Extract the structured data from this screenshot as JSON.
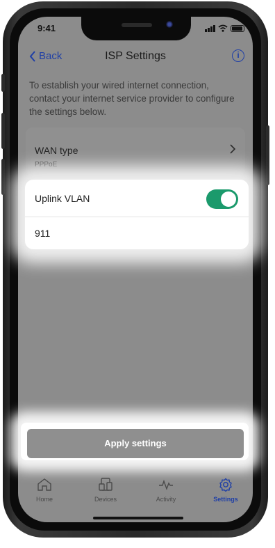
{
  "status_bar": {
    "time": "9:41"
  },
  "nav": {
    "back_label": "Back",
    "title": "ISP Settings"
  },
  "description": "To establish your wired internet connection, contact your internet service provider to configure the settings below.",
  "wan": {
    "label": "WAN type",
    "value": "PPPoE"
  },
  "vlan": {
    "label": "Uplink VLAN",
    "enabled": true,
    "value": "911"
  },
  "apply_button": {
    "label": "Apply settings"
  },
  "tab_bar": {
    "items": [
      {
        "label": "Home",
        "icon": "home-icon"
      },
      {
        "label": "Devices",
        "icon": "devices-icon"
      },
      {
        "label": "Activity",
        "icon": "activity-icon"
      },
      {
        "label": "Settings",
        "icon": "settings-icon",
        "active": true
      }
    ]
  },
  "colors": {
    "accent": "#1f3fa6",
    "toggle_on": "#1b9a6c",
    "dim_overlay": "#8c8c8c"
  }
}
